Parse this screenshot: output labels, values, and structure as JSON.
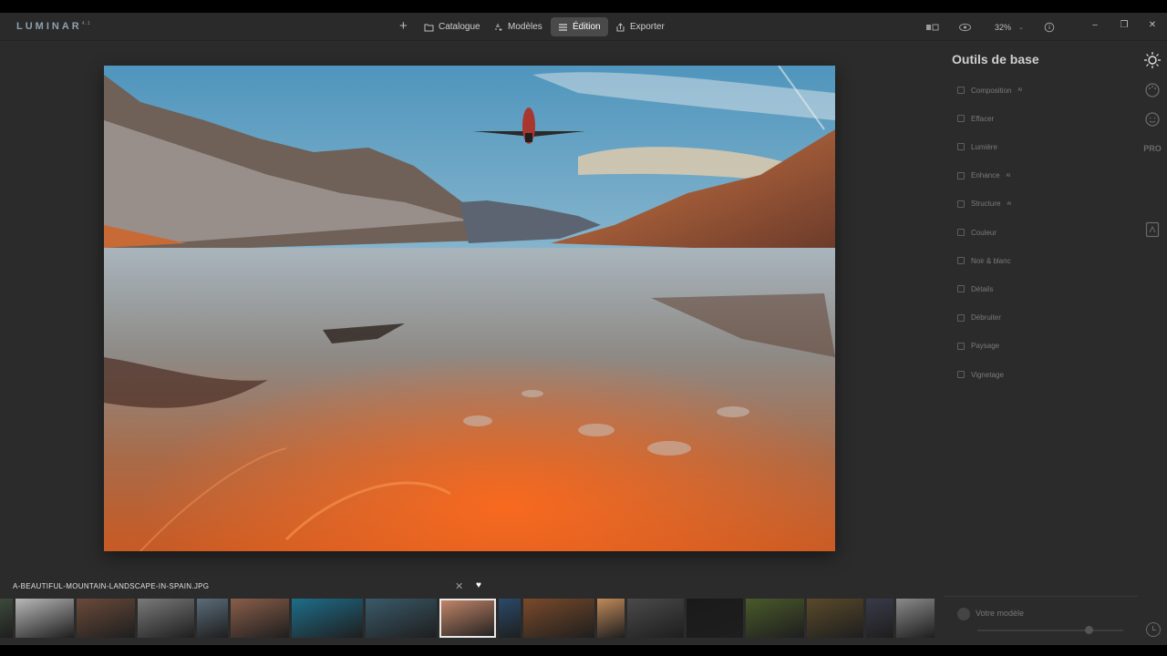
{
  "app": {
    "logo": "LUMINAR",
    "logo_suffix": "4.1"
  },
  "topbar": {
    "add_symbol": "+",
    "nav": [
      {
        "label": "Catalogue",
        "icon": "folder-icon"
      },
      {
        "label": "Modèles",
        "icon": "sparkle-icon"
      },
      {
        "label": "Édition",
        "icon": "sliders-icon",
        "active": true
      },
      {
        "label": "Exporter",
        "icon": "share-icon"
      }
    ],
    "zoom": "32%",
    "window_controls": [
      "minimize",
      "restore",
      "close"
    ]
  },
  "panel": {
    "title": "Outils de base",
    "tools": [
      {
        "label": "Composition",
        "ai": "AI"
      },
      {
        "label": "Effacer",
        "ai": ""
      },
      {
        "label": "Lumière",
        "ai": ""
      },
      {
        "label": "Enhance",
        "ai": "AI"
      },
      {
        "label": "Structure",
        "ai": "AI"
      },
      {
        "label": "Couleur",
        "ai": ""
      },
      {
        "label": "Noir & blanc",
        "ai": ""
      },
      {
        "label": "Détails",
        "ai": ""
      },
      {
        "label": "Débruiter",
        "ai": ""
      },
      {
        "label": "Paysage",
        "ai": ""
      },
      {
        "label": "Vignetage",
        "ai": ""
      }
    ],
    "side_icons": [
      "sun-icon",
      "palette-icon",
      "smiley-icon",
      "pro-icon",
      "portrait-icon"
    ],
    "pro_label": "PRO"
  },
  "filmstrip": {
    "filename": "A-BEAUTIFUL-MOUNTAIN-LANDSCAPE-IN-SPAIN.JPG",
    "close_symbol": "✕",
    "heart_symbol": "♥",
    "selected_index": 8,
    "thumb_colors": [
      "#3c4a3c",
      "#b8b8b8",
      "#6a4a3a",
      "#7a7a7a",
      "#5b6c7a",
      "#8a5e4a",
      "#1d6e8a",
      "#3a5a6a",
      "#c7896b",
      "#2a4a6a",
      "#7a4a2a",
      "#c08a5a",
      "#4a4a4a",
      "#1a1a1a",
      "#4a5a2a",
      "#5a4a2a",
      "#3a3a4a",
      "#8a8a8a"
    ]
  },
  "model": {
    "label": "Votre modèle"
  }
}
